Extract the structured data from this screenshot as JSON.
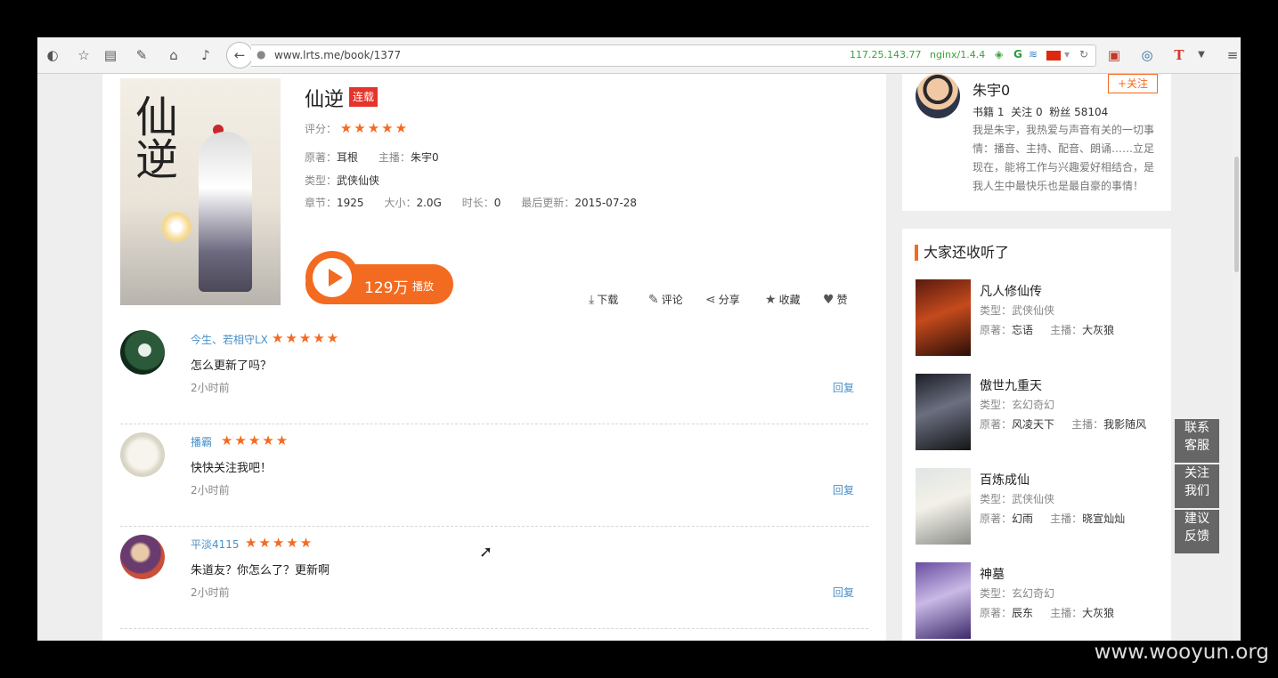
{
  "browser": {
    "url": "www.lrts.me/book/1377",
    "ip": "117.25.143.77",
    "server": "nginx/1.4.4"
  },
  "book": {
    "title": "仙逆",
    "badge": "连载",
    "rating_label": "评分：",
    "rating_stars": "★★★★★",
    "author_label": "原著：",
    "author": "耳根",
    "host_label": "主播：",
    "host": "朱宇0",
    "type_label": "类型：",
    "type": "武侠仙侠",
    "chapters_label": "章节：",
    "chapters": "1925",
    "size_label": "大小：",
    "size": "2.0G",
    "duration_label": "时长：",
    "duration": "0",
    "updated_label": "最后更新：",
    "updated": "2015-07-28",
    "cover_title": "仙逆",
    "play_count": "129万",
    "play_label": "播放"
  },
  "actions": {
    "download": "下载",
    "comment": "评论",
    "share": "分享",
    "favorite": "收藏",
    "like": "赞"
  },
  "comments": [
    {
      "user": "今生、若相守LX",
      "stars": "★★★★★",
      "text": "怎么更新了吗？",
      "time": "2小时前",
      "reply": "回复"
    },
    {
      "user": "播霸",
      "stars": "★★★★★",
      "text": "快快关注我吧！",
      "time": "2小时前",
      "reply": "回复"
    },
    {
      "user": "平淡4115",
      "stars": "★★★★★",
      "text": "朱道友？你怎么了？更新啊",
      "time": "2小时前",
      "reply": "回复"
    }
  ],
  "anchor": {
    "name": "朱宇0",
    "follow": "+关注",
    "books_label": "书籍",
    "books": "1",
    "follows_label": "关注",
    "follows": "0",
    "fans_label": "粉丝",
    "fans": "58104",
    "bio": "我是朱宇，我热爱与声音有关的一切事情：播音、主持、配音、朗诵……立足现在，能将工作与兴趣爱好相结合，是我人生中最快乐也是最自豪的事情！"
  },
  "recommend": {
    "heading": "大家还收听了",
    "type_label": "类型：",
    "author_label": "原著：",
    "host_label": "主播：",
    "items": [
      {
        "title": "凡人修仙传",
        "type": "武侠仙侠",
        "author": "忘语",
        "host": "大灰狼"
      },
      {
        "title": "傲世九重天",
        "type": "玄幻奇幻",
        "author": "风凌天下",
        "host": "我影随风"
      },
      {
        "title": "百炼成仙",
        "type": "武侠仙侠",
        "author": "幻雨",
        "host": "晓宣灿灿"
      },
      {
        "title": "神墓",
        "type": "玄幻奇幻",
        "author": "辰东",
        "host": "大灰狼"
      }
    ]
  },
  "float_buttons": [
    {
      "l1": "联系",
      "l2": "客服"
    },
    {
      "l1": "关注",
      "l2": "我们"
    },
    {
      "l1": "建议",
      "l2": "反馈"
    }
  ],
  "watermark": "www.wooyun.org",
  "colors": {
    "accent": "#f36b21",
    "link": "#4a90c8",
    "badge": "#e5342b"
  }
}
